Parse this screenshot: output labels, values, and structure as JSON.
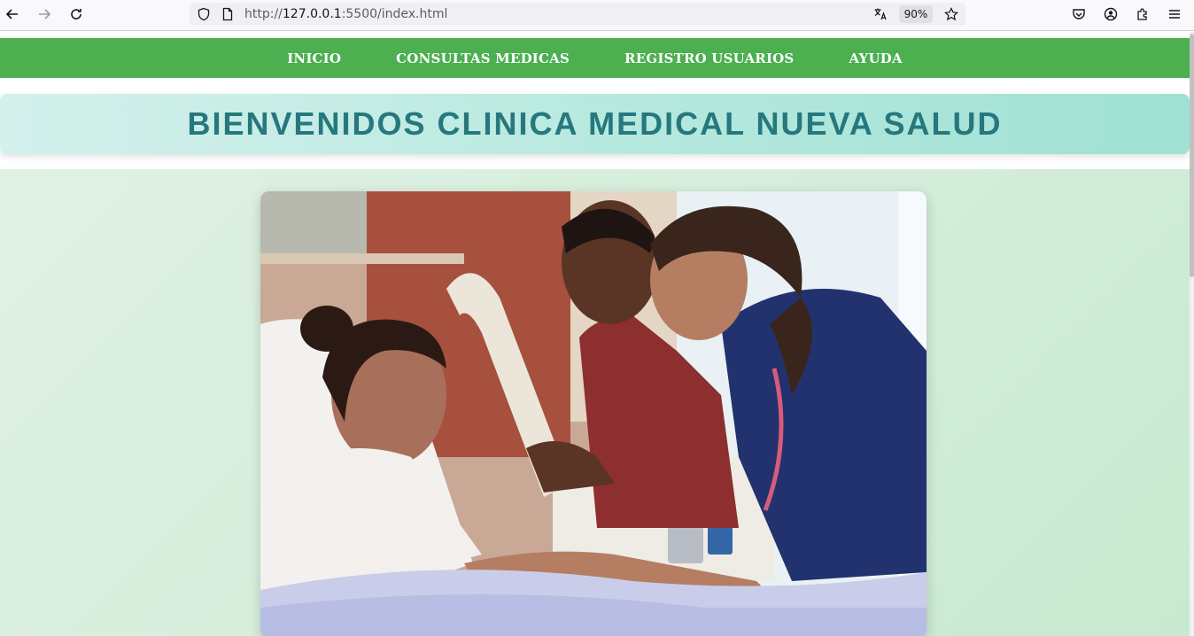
{
  "browser": {
    "url_prefix": "http://",
    "url_host": "127.0.0.1",
    "url_rest": ":5500/index.html",
    "zoom": "90%",
    "icons": [
      "back-arrow-icon",
      "forward-arrow-icon",
      "reload-icon",
      "shield-icon",
      "page-icon",
      "translate-icon",
      "star-icon",
      "pocket-icon",
      "account-icon",
      "extensions-icon",
      "menu-icon"
    ]
  },
  "nav": {
    "items": [
      {
        "label": "INICIO"
      },
      {
        "label": "CONSULTAS MEDICAS"
      },
      {
        "label": "REGISTRO USUARIOS"
      },
      {
        "label": "AYUDA"
      }
    ]
  },
  "hero": {
    "title": "BIENVENIDOS CLINICA MEDICAL NUEVA SALUD"
  },
  "colors": {
    "nav_bg": "#4caf50",
    "title_color": "#26787e",
    "hero_bg": "#b8e9df",
    "page_bg": "#d6eedc"
  }
}
